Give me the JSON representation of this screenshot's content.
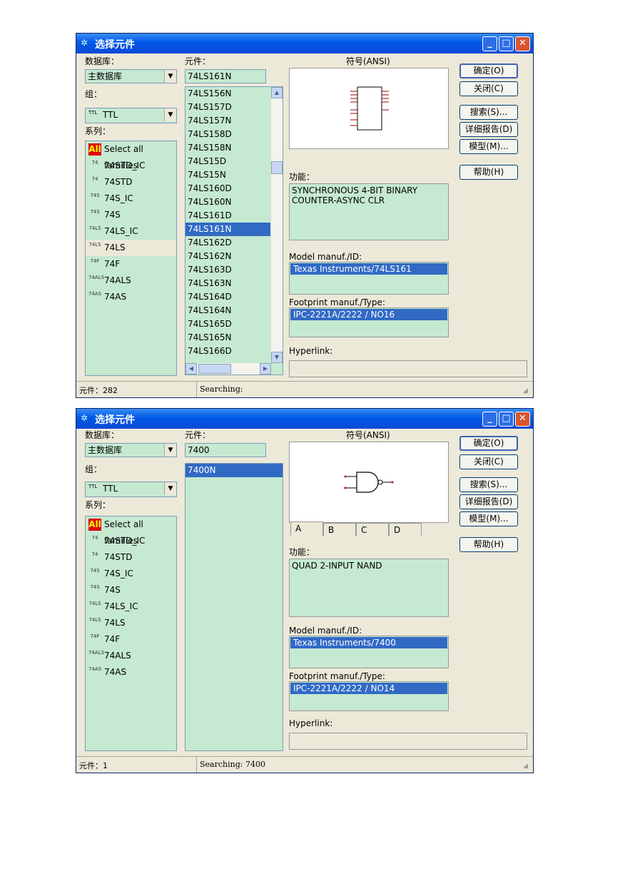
{
  "window1": {
    "title": "选择元件",
    "database_label": "数据库：",
    "database_value": "主数据库",
    "group_label": "组：",
    "group_icon_text": "TTL",
    "group_value": "TTL",
    "series_label": "系列：",
    "component_label": "元件：",
    "component_value": "74LS161N",
    "symbol_label": "符号(ANSI)",
    "function_label": "功能：",
    "function_text": "SYNCHRONOUS 4-BIT BINARY COUNTER-ASYNC CLR",
    "model_label": "Model manuf./ID:",
    "model_value": "Texas Instruments/74LS161",
    "footprint_label": "Footprint manuf./Type:",
    "footprint_value": "IPC-2221A/2222 / NO16",
    "hyperlink_label": "Hyperlink:",
    "families": [
      {
        "icon": "All",
        "label": "Select all families"
      },
      {
        "icon": "74",
        "label": "74STD_IC"
      },
      {
        "icon": "74",
        "label": "74STD"
      },
      {
        "icon": "74S",
        "label": "74S_IC"
      },
      {
        "icon": "74S",
        "label": "74S"
      },
      {
        "icon": "74LS",
        "label": "74LS_IC"
      },
      {
        "icon": "74LS",
        "label": "74LS"
      },
      {
        "icon": "74F",
        "label": "74F"
      },
      {
        "icon": "74ALS",
        "label": "74ALS"
      },
      {
        "icon": "74AS",
        "label": "74AS"
      }
    ],
    "components": [
      "74LS156N",
      "74LS157D",
      "74LS157N",
      "74LS158D",
      "74LS158N",
      "74LS15D",
      "74LS15N",
      "74LS160D",
      "74LS160N",
      "74LS161D",
      "74LS161N",
      "74LS162D",
      "74LS162N",
      "74LS163D",
      "74LS163N",
      "74LS164D",
      "74LS164N",
      "74LS165D",
      "74LS165N",
      "74LS166D"
    ],
    "status_count": "元件：282",
    "status_search": "Searching:"
  },
  "window2": {
    "title": "选择元件",
    "database_label": "数据库：",
    "database_value": "主数据库",
    "group_label": "组：",
    "group_icon_text": "TTL",
    "group_value": "TTL",
    "series_label": "系列：",
    "component_label": "元件：",
    "component_value": "7400",
    "symbol_label": "符号(ANSI)",
    "tabs": [
      "A",
      "B",
      "C",
      "D"
    ],
    "function_label": "功能：",
    "function_text": "QUAD 2-INPUT NAND",
    "model_label": "Model manuf./ID:",
    "model_value": "Texas Instruments/7400",
    "footprint_label": "Footprint manuf./Type:",
    "footprint_value": "IPC-2221A/2222 / NO14",
    "hyperlink_label": "Hyperlink:",
    "families": [
      {
        "icon": "All",
        "label": "Select all families"
      },
      {
        "icon": "74",
        "label": "74STD_IC"
      },
      {
        "icon": "74",
        "label": "74STD"
      },
      {
        "icon": "74S",
        "label": "74S_IC"
      },
      {
        "icon": "74S",
        "label": "74S"
      },
      {
        "icon": "74LS",
        "label": "74LS_IC"
      },
      {
        "icon": "74LS",
        "label": "74LS"
      },
      {
        "icon": "74F",
        "label": "74F"
      },
      {
        "icon": "74ALS",
        "label": "74ALS"
      },
      {
        "icon": "74AS",
        "label": "74AS"
      }
    ],
    "components": [
      "7400N"
    ],
    "status_count": "元件：1",
    "status_search": "Searching: 7400"
  },
  "buttons": {
    "ok": "确定(O)",
    "close": "关闭(C)",
    "search": "搜索(S)...",
    "detail_report": "详细报告(D)",
    "model": "模型(M)...",
    "help": "帮助(H)"
  },
  "colors": {
    "list_bg": "#c5e9d1",
    "selection": "#316ac5",
    "title_bar": "#0058e6"
  }
}
